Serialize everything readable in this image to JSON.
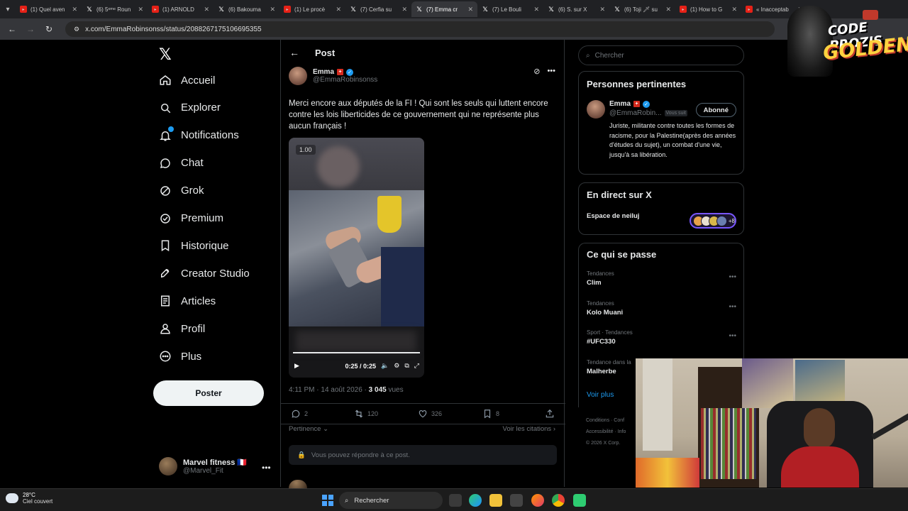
{
  "browser": {
    "tabs": [
      {
        "title": "(1) Quel aven",
        "favicon": "youtube-icon"
      },
      {
        "title": "(6) 5ᵉᵐᵉ Roun",
        "favicon": "x-icon"
      },
      {
        "title": "(1) ARNOLD",
        "favicon": "youtube-icon"
      },
      {
        "title": "(6) Bakouma",
        "favicon": "x-icon"
      },
      {
        "title": "(1) Le procè",
        "favicon": "youtube-icon"
      },
      {
        "title": "(7) Cerfia su",
        "favicon": "x-icon"
      },
      {
        "title": "(7) Emma cr",
        "favicon": "x-icon",
        "active": true
      },
      {
        "title": "(7) Le Bouli",
        "favicon": "x-icon"
      },
      {
        "title": "(6) S. sur X",
        "favicon": "x-icon"
      },
      {
        "title": "(6) Toji 🗡 su",
        "favicon": "x-icon"
      },
      {
        "title": "(1) How to G",
        "favicon": "youtube-icon"
      },
      {
        "title": "« Inacceptab",
        "favicon": "youtube-icon"
      }
    ],
    "url": "x.com/EmmaRobinsonss/status/2088267175106695355"
  },
  "nav": {
    "items": [
      {
        "label": "Accueil",
        "icon": "home-icon"
      },
      {
        "label": "Explorer",
        "icon": "search-icon"
      },
      {
        "label": "Notifications",
        "icon": "bell-icon"
      },
      {
        "label": "Chat",
        "icon": "chat-icon"
      },
      {
        "label": "Grok",
        "icon": "grok-icon"
      },
      {
        "label": "Premium",
        "icon": "premium-icon"
      },
      {
        "label": "Historique",
        "icon": "bookmark-icon"
      },
      {
        "label": "Creator Studio",
        "icon": "rocket-icon"
      },
      {
        "label": "Articles",
        "icon": "article-icon"
      },
      {
        "label": "Profil",
        "icon": "profile-icon"
      },
      {
        "label": "Plus",
        "icon": "more-icon"
      }
    ],
    "post_button": "Poster",
    "me": {
      "name": "Marvel fitness 🇫🇷",
      "handle": "@Marvel_Fit"
    }
  },
  "post": {
    "header_title": "Post",
    "author_name": "Emma",
    "author_handle": "@EmmaRobinsonss",
    "text": "Merci encore aux députés de la FI ! Qui sont les seuls qui luttent encore contre les lois liberticides de ce gouvernement qui ne représente plus aucun français !",
    "video": {
      "badge": "1.00",
      "time": "0:25 / 0:25",
      "progress": 1.0
    },
    "timestamp": "4:11 PM · 14 août 2026 · ",
    "views_count": "3 045",
    "views_label": " vues",
    "actions": {
      "replies": "2",
      "reposts": "120",
      "likes": "326",
      "bookmarks": "8"
    },
    "relevance_label": "Pertinence",
    "quotes_label": "Voir les citations",
    "reply_notice": "Vous pouvez répondre à ce post."
  },
  "sidebar": {
    "search_placeholder": "Chercher",
    "relevant": {
      "title": "Personnes pertinentes",
      "name": "Emma",
      "handle": "@EmmaRobin...",
      "follows_you": "Vous suit",
      "button": "Abonné",
      "bio": "Juriste, militante contre toutes les formes de racisme, pour la Palestine(après des années d'études du sujet), un combat d'une vie, jusqu'à sa libération."
    },
    "live": {
      "title": "En direct sur X",
      "space": "Espace de neiluj",
      "extra": "+8"
    },
    "trends": {
      "title": "Ce qui se passe",
      "items": [
        {
          "category": "Tendances",
          "name": "Clim"
        },
        {
          "category": "Tendances",
          "name": "Kolo Muani"
        },
        {
          "category": "Sport · Tendances",
          "name": "#UFC330"
        },
        {
          "category": "Tendance dans la",
          "name": "Malherbe"
        }
      ],
      "see_more": "Voir plus"
    },
    "footer": {
      "line1": "Conditions  ·  Conf",
      "line2": "Accessibilité  ·  Info",
      "line3": "© 2026 X Corp."
    }
  },
  "overlay": {
    "line1": "CODE PROZIS",
    "line2": "GOLDENG"
  },
  "taskbar": {
    "temp": "28°C",
    "weather": "Ciel couvert",
    "search": "Rechercher"
  }
}
